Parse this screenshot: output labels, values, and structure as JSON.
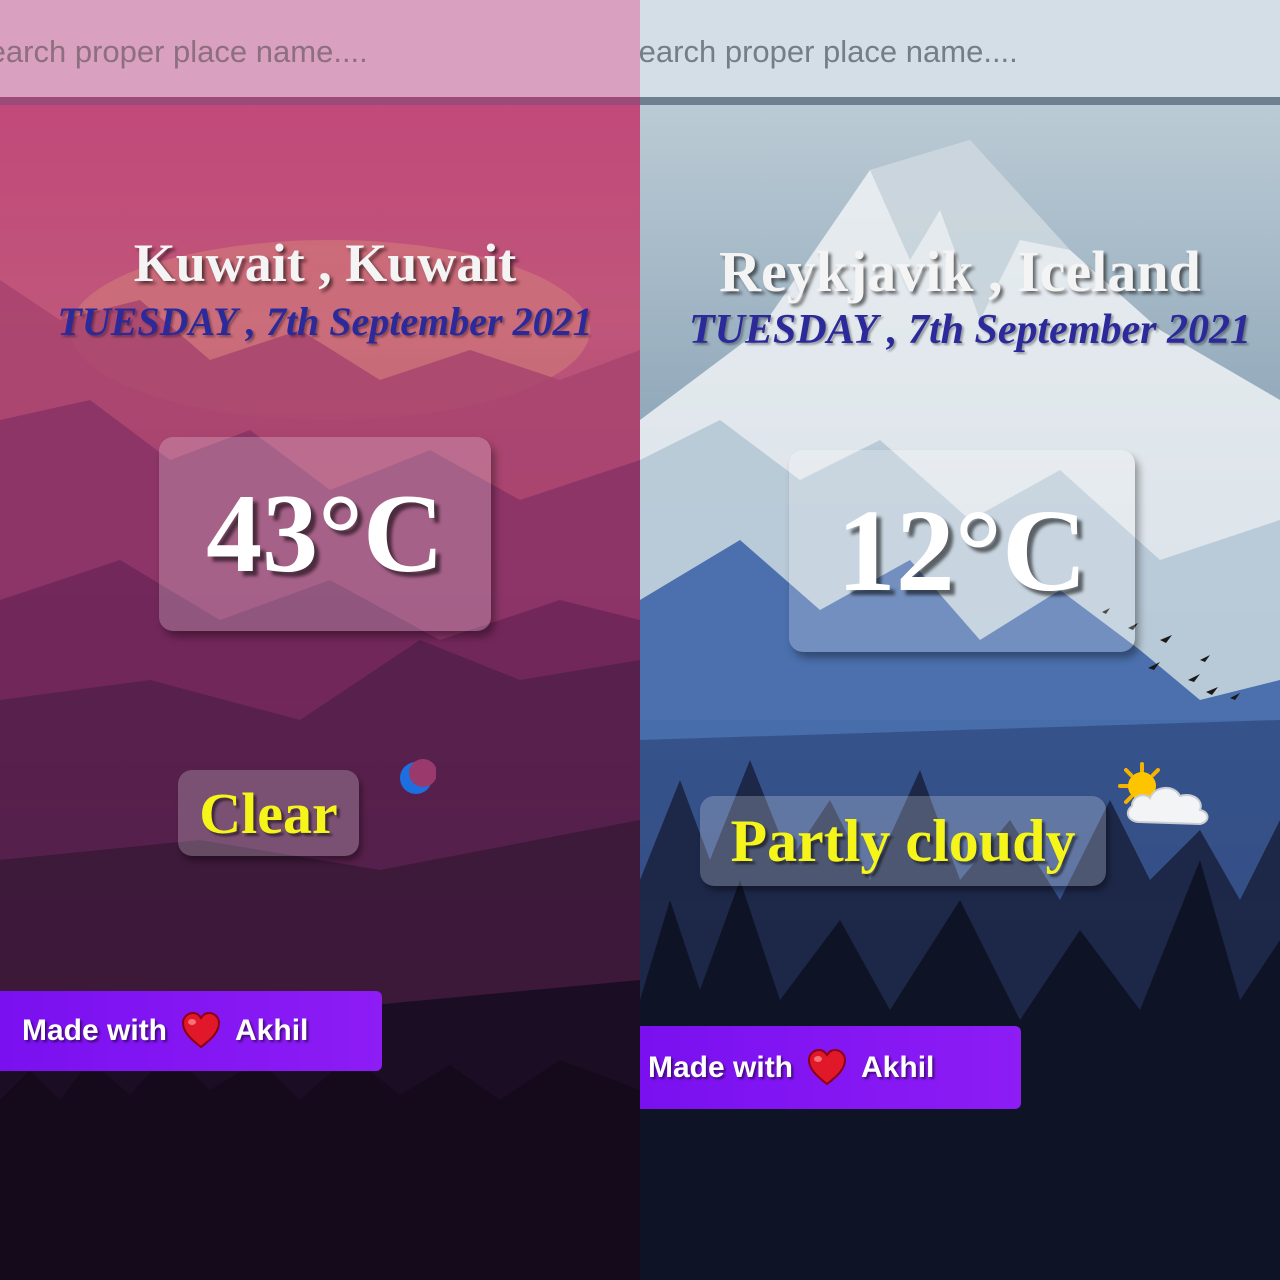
{
  "panels": [
    {
      "search": {
        "placeholder": "Search proper place name...."
      },
      "location": "Kuwait , Kuwait",
      "date": "TUESDAY , 7th September 2021",
      "temperature": "43°C",
      "condition": "Clear",
      "condition_icon": "crescent-moon-icon",
      "footer": {
        "prefix": "Made with",
        "author": "Akhil"
      },
      "theme": {
        "sky": "#b93a73",
        "accent": "#f5f51a",
        "date_color": "#2c2a9a"
      }
    },
    {
      "search": {
        "placeholder": "Search proper place name...."
      },
      "location": "Reykjavik , Iceland",
      "date": "TUESDAY , 7th September 2021",
      "temperature": "12°C",
      "condition": "Partly cloudy",
      "condition_icon": "sun-behind-cloud-icon",
      "footer": {
        "prefix": "Made with",
        "author": "Akhil"
      },
      "theme": {
        "sky": "#8fa8b8",
        "accent": "#f5f51a",
        "date_color": "#2c2a9a"
      }
    }
  ],
  "footer_button_color": "#8515f3"
}
